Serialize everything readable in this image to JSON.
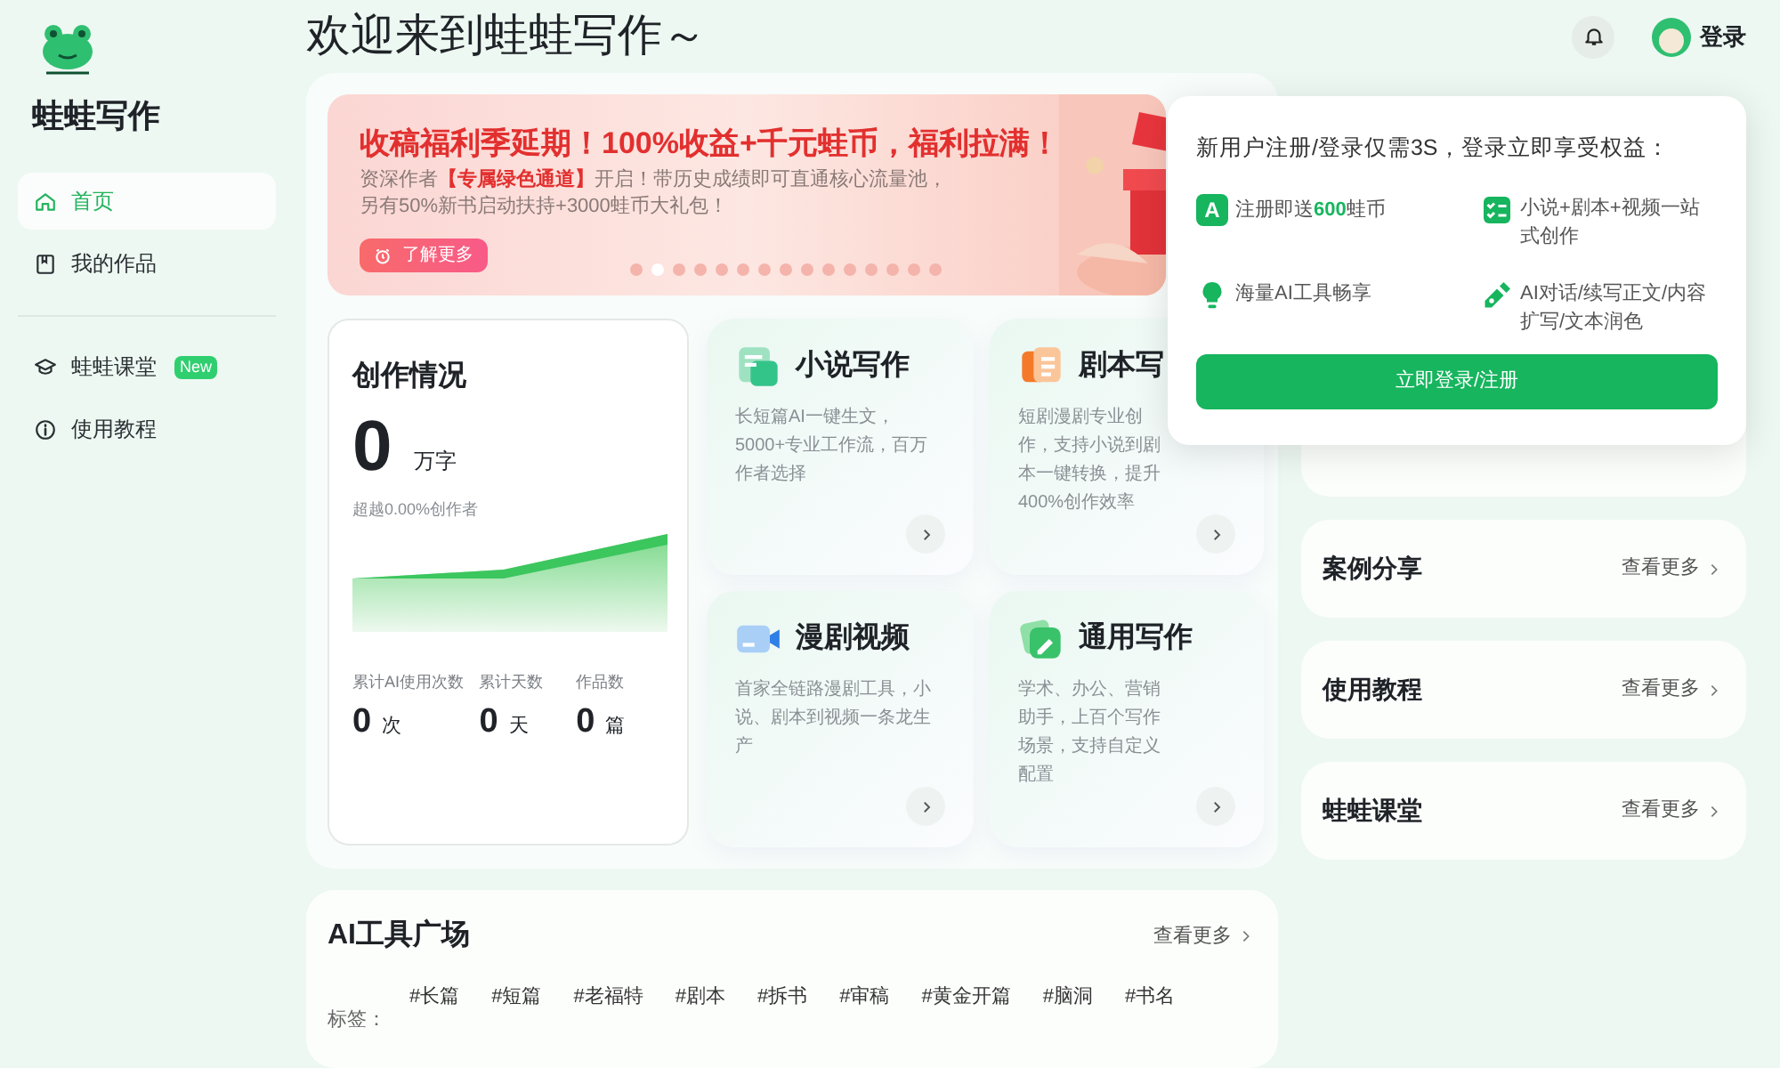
{
  "app": {
    "name": "蛙蛙写作"
  },
  "sidebar": {
    "items": [
      {
        "label": "首页",
        "selected": true
      },
      {
        "label": "我的作品",
        "selected": false
      },
      {
        "label": "蛙蛙课堂",
        "selected": false,
        "badge": "New"
      },
      {
        "label": "使用教程",
        "selected": false
      }
    ]
  },
  "header": {
    "title": "欢迎来到蛙蛙写作～",
    "login": "登录"
  },
  "banner": {
    "headline": "收稿福利季延期！100%收益+千元蛙币，福利拉满！",
    "lines": [
      "资深作者**【专属绿色通道】**开启！带历史成绩即可直通核心流量池，",
      "另有50%新书启动扶持+3000蛙币大礼包！"
    ],
    "button": "了解更多",
    "dots": [
      {
        "selected": false
      },
      {
        "selected": true
      },
      {
        "selected": false
      },
      {
        "selected": false
      },
      {
        "selected": false
      },
      {
        "selected": false
      },
      {
        "selected": false
      },
      {
        "selected": false
      },
      {
        "selected": false
      },
      {
        "selected": false
      },
      {
        "selected": false
      },
      {
        "selected": false
      },
      {
        "selected": false
      },
      {
        "selected": false
      },
      {
        "selected": false
      }
    ]
  },
  "stats": {
    "title": "创作情况",
    "value": "0",
    "unit": "万字",
    "rank": "超越0.00%创作者",
    "items": [
      {
        "label": "累计AI使用次数",
        "value": "0",
        "unit": "次"
      },
      {
        "label": "累计天数",
        "value": "0",
        "unit": "天"
      },
      {
        "label": "作品数",
        "value": "0",
        "unit": "篇"
      }
    ]
  },
  "features": [
    {
      "kind": "novel",
      "title": "小说写作",
      "description": "长短篇AI一键生文，5000+专业工作流，百万作者选择"
    },
    {
      "kind": "script",
      "title": "剧本写",
      "description": "短剧漫剧专业创作，支持小说到剧本一键转换，提升400%创作效率"
    },
    {
      "kind": "video",
      "title": "漫剧视频",
      "description": "首家全链路漫剧工具，小说、剧本到视频一条龙生产"
    },
    {
      "kind": "general",
      "title": "通用写作",
      "description": "学术、办公、营销助手，上百个写作场景，支持自定义配置"
    }
  ],
  "side_sections": [
    {
      "title": "案例分享",
      "more": "查看更多"
    },
    {
      "title": "使用教程",
      "more": "查看更多"
    },
    {
      "title": "蛙蛙课堂",
      "more": "查看更多"
    }
  ],
  "tools": {
    "title": "AI工具广场",
    "more": "查看更多",
    "tags_label": "标签：",
    "tags": [
      "#长篇",
      "#短篇",
      "#老福特",
      "#剧本",
      "#拆书",
      "#审稿",
      "#黄金开篇",
      "#脑洞",
      "#书名"
    ]
  },
  "login_popup": {
    "heading": "新用户注册/登录仅需3S，登录立即享受权益：",
    "benefits": [
      {
        "kind": "coin",
        "badge": "A",
        "text": "注册即送**600**蛙币"
      },
      {
        "kind": "list",
        "text": "小说+剧本+视频一站式创作"
      },
      {
        "kind": "bulb",
        "text": "海量AI工具畅享"
      },
      {
        "kind": "pen",
        "text": "AI对话/续写正文/内容扩写/文本润色"
      }
    ],
    "button": "立即登录/注册"
  }
}
